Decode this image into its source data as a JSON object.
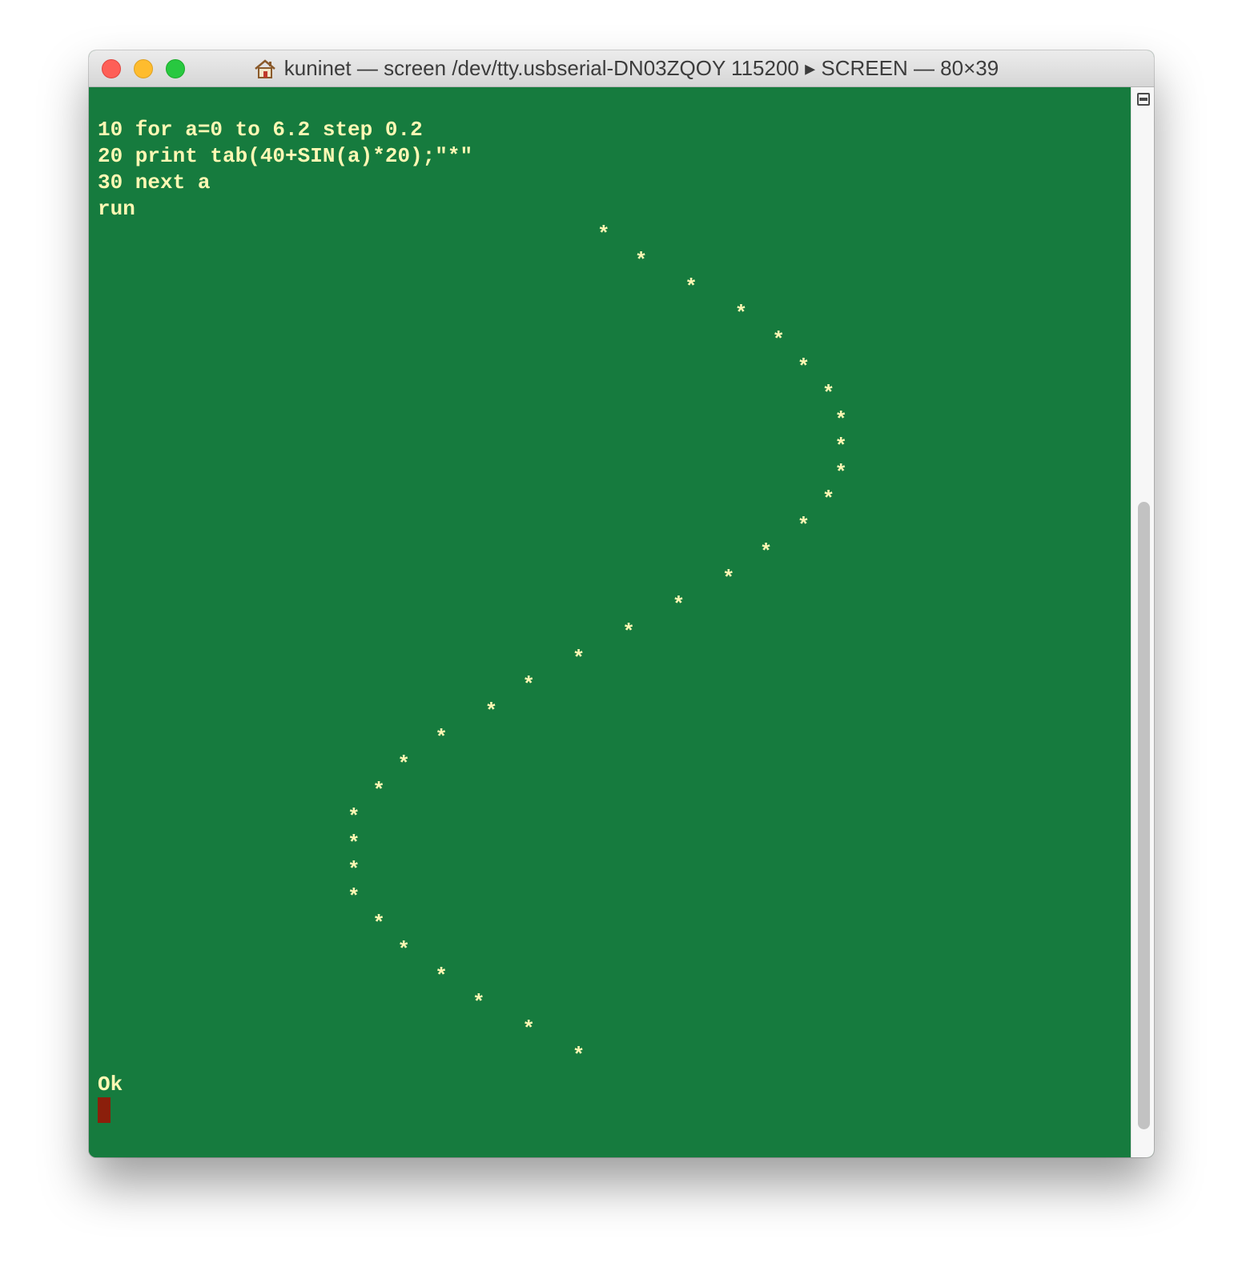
{
  "window": {
    "title": "kuninet — screen /dev/tty.usbserial-DN03ZQOY 115200 ▸ SCREEN — 80×39",
    "title_icon": "home-icon",
    "controls": [
      "close-button",
      "minimize-button",
      "zoom-button"
    ]
  },
  "terminal": {
    "colors": {
      "background": "#167b3e",
      "foreground": "#fff8b4",
      "cursor": "#8b1f0b"
    },
    "program_lines": [
      "10 for a=0 to 6.2 step 0.2",
      "20 print tab(40+SIN(a)*20);\"*\"",
      "30 next a",
      "run"
    ],
    "output_glyph": "*",
    "output_count": 32,
    "prompt": "Ok"
  },
  "scrollbar": {
    "split_icon": "split-pane-icon"
  }
}
